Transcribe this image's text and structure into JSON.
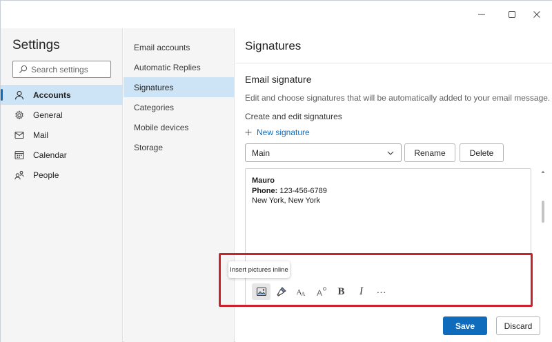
{
  "window": {
    "controls": [
      "minimize-icon",
      "maximize-icon",
      "close-icon"
    ]
  },
  "nav": {
    "title": "Settings",
    "search_placeholder": "Search settings",
    "items": [
      {
        "label": "Accounts",
        "icon": "person-icon",
        "active": true
      },
      {
        "label": "General",
        "icon": "gear-icon",
        "active": false
      },
      {
        "label": "Mail",
        "icon": "mail-icon",
        "active": false
      },
      {
        "label": "Calendar",
        "icon": "calendar-icon",
        "active": false
      },
      {
        "label": "People",
        "icon": "people-icon",
        "active": false
      }
    ]
  },
  "subnav": {
    "items": [
      {
        "label": "Email accounts",
        "active": false
      },
      {
        "label": "Automatic Replies",
        "active": false
      },
      {
        "label": "Signatures",
        "active": true
      },
      {
        "label": "Categories",
        "active": false
      },
      {
        "label": "Mobile devices",
        "active": false
      },
      {
        "label": "Storage",
        "active": false
      }
    ]
  },
  "content": {
    "title": "Signatures",
    "section_title": "Email signature",
    "description": "Edit and choose signatures that will be automatically added to your email message.",
    "create_label": "Create and edit signatures",
    "new_signature": "New signature",
    "selected_signature": "Main",
    "rename_label": "Rename",
    "delete_label": "Delete",
    "signature": {
      "name": "Mauro",
      "phone_label": "Phone:",
      "phone": "123-456-6789",
      "location": "New York, New York"
    },
    "tooltip": "Insert pictures inline",
    "toolbar": [
      "insert-picture-icon",
      "format-painter-icon",
      "font-size-icon",
      "superscript-icon",
      "bold-icon",
      "italic-icon",
      "more-icon"
    ],
    "toolbar_text": {
      "bold": "B",
      "italic": "I",
      "more": "···"
    },
    "save_label": "Save",
    "discard_label": "Discard"
  },
  "colors": {
    "accent": "#0f6cbd",
    "highlight_box": "#c8232c",
    "selected_bg": "#cde4f7"
  }
}
